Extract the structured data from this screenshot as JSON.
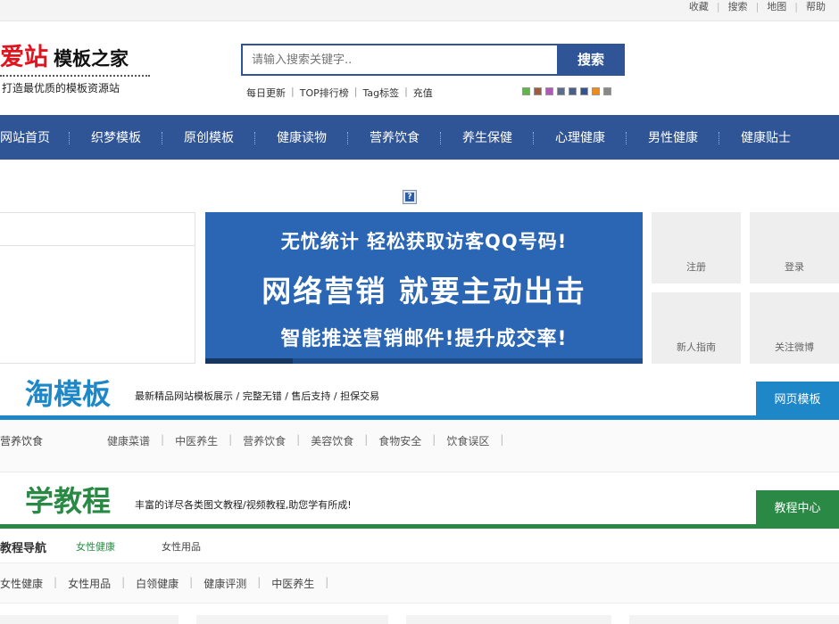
{
  "topbar": {
    "links": [
      "收藏",
      "搜索",
      "地图",
      "帮助"
    ]
  },
  "logo": {
    "red": "爱站",
    "black": "模板之家",
    "tagline": "打造最优质的模板资源站"
  },
  "search": {
    "placeholder": "请输入搜索关键字..",
    "button": "搜索",
    "sublinks": [
      "每日更新",
      "TOP排行榜",
      "Tag标签",
      "充值"
    ]
  },
  "theme_swatches": [
    "#5fb54a",
    "#a35a3c",
    "#b05ab8",
    "#5c6c8e",
    "#4a5f85",
    "#2f5597",
    "#f08a1c",
    "#888888"
  ],
  "nav": {
    "items": [
      "网站首页",
      "织梦模板",
      "原创模板",
      "健康读物",
      "营养饮食",
      "养生保健",
      "心理健康",
      "男性健康",
      "健康贴士"
    ]
  },
  "banner": {
    "line1": "无忧统计 轻松获取访客QQ号码!",
    "line2": "网络营销 就要主动出击",
    "line3": "智能推送营销邮件!提升成交率!"
  },
  "tiles": [
    "注册",
    "登录",
    "新人指南",
    "关注微博"
  ],
  "section1": {
    "title": "淘模板",
    "desc": "最新精品网站模板展示 / 完整无错 / 售后支持 / 担保交易",
    "tab": "网页模板",
    "row_label": "营养饮食",
    "links": [
      "健康菜谱",
      "中医养生",
      "营养饮食",
      "美容饮食",
      "食物安全",
      "饮食误区"
    ]
  },
  "section2": {
    "title": "学教程",
    "desc": "丰富的详尽各类图文教程/视频教程,助您学有所成!",
    "tab": "教程中心",
    "nav_label": "教程导航",
    "nav_tabs": [
      "女性健康",
      "女性用品"
    ],
    "links": [
      "女性健康",
      "女性用品",
      "白领健康",
      "健康评测",
      "中医养生"
    ]
  },
  "colors": {
    "nav_blue": "#2f5597",
    "section1_blue": "#1d87c8",
    "section2_green": "#2a8a45",
    "logo_red": "#e0141e"
  }
}
